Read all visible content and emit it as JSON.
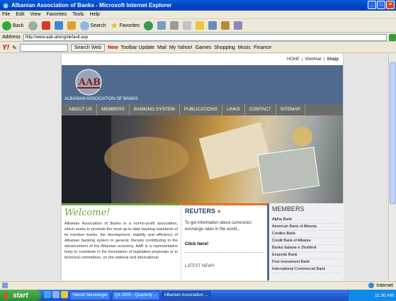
{
  "window": {
    "title": "Albanian Association of Banks - Microsoft Internet Explorer"
  },
  "menu": [
    "File",
    "Edit",
    "View",
    "Favorites",
    "Tools",
    "Help"
  ],
  "toolbar": {
    "back": "Back",
    "search": "Search",
    "favorites": "Favorites"
  },
  "address": {
    "label": "Address",
    "url": "http://www.aab.al/eng/default.asp"
  },
  "yahoo": {
    "search_btn": "Search Web",
    "new_label": "New",
    "toolbar_update": "Toolbar Update",
    "mail": "Mail",
    "my_yahoo": "My Yahoo!",
    "games": "Games",
    "shopping": "Shopping",
    "music": "Music",
    "finance": "Finance"
  },
  "site": {
    "topnav": [
      "HOME",
      "WebMail",
      "Shqip"
    ],
    "logo_sub": "ALBANIAN ASSOCIATION OF BANKS",
    "nav": [
      "ABOUT US",
      "MEMBERS",
      "BANKING SYSTEM",
      "PUBLICATIONS",
      "LINKS",
      "CONTACT",
      "SITEMAP"
    ],
    "welcome": {
      "title": "Welcome!",
      "text": "Albanian Association of Banks is a not-for-profit association, which seeks to promote the most up-to-date banking standards of its member banks, the development, stability and efficiency of Albanian banking system in general, thereby contributing to the advancement of the Albanian economy. AAB is a representative body to contribute in the formulation of legislative proposals or in technical committees, on the national and international"
    },
    "reuters": {
      "brand": "REUTERS",
      "text": "To get information about currencies' exchange rates in the world...",
      "click": "Click here!",
      "latest": "LATEST NEWS"
    },
    "members": {
      "title": "MEMBERS",
      "list": [
        "Alpha Bank",
        "American Bank of Albania",
        "Credins Bank",
        "Credit Bank of Albania",
        "Banka Italiane e Zhvillimit",
        "Emporiki Bank",
        "First Investment Bank",
        "International Commercial Bank"
      ]
    }
  },
  "status": {
    "zone": "Internet"
  },
  "taskbar": {
    "start": "start",
    "tasks": [
      "Yahoo! Messenger",
      "Q4 2005 - Quarterly ...",
      "Albanian Association ..."
    ],
    "clock": "11:30 AM"
  },
  "colors": {
    "titlebar": "#0246c9",
    "header": "#4f6b8f",
    "welcome": "#6fa23a",
    "reuters_accent": "#e87020"
  }
}
